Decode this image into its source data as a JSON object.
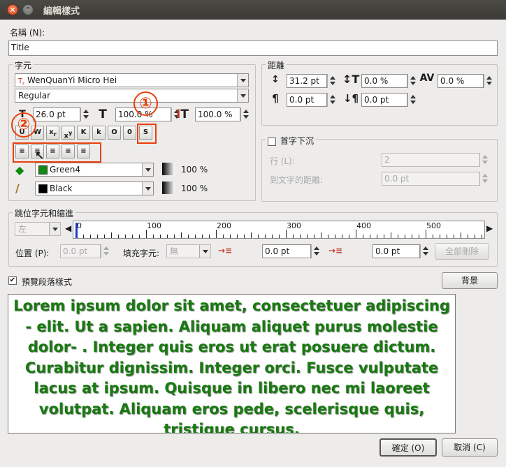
{
  "window": {
    "title": "編輯樣式"
  },
  "name": {
    "label": "名稱 (N):",
    "value": "Title"
  },
  "char_group": {
    "title": "字元",
    "font": "WenQuanYi Micro Hei",
    "style": "Regular",
    "size": "26.0 pt",
    "scale_h": "100.0 %",
    "scale_v": "100.0 %",
    "fill_color": "Green4",
    "fill_shade": "100 %",
    "stroke_color": "Black",
    "stroke_shade": "100 %",
    "marker1": "①",
    "marker2": "②"
  },
  "spacing_group": {
    "title": "距離",
    "line_spacing": "31.2 pt",
    "tracking": "0.0 %",
    "kerning": "0.0 %",
    "space_before": "0.0 pt",
    "space_after": "0.0 pt"
  },
  "dropcap": {
    "title": "首字下沉",
    "lines_label": "行 (L):",
    "lines_value": "2",
    "dist_label": "到文字的距離:",
    "dist_value": "0.0 pt"
  },
  "tabs": {
    "title": "跳位字元和縮進",
    "align": "左",
    "position_label": "位置 (P):",
    "position_value": "0.0 pt",
    "fill_label": "填充字元:",
    "fill_value": "無",
    "first_indent": "0.0 pt",
    "left_indent": "0.0 pt",
    "delete_all": "全部刪除",
    "ruler_labels": [
      "0",
      "100",
      "200",
      "300",
      "400",
      "500"
    ]
  },
  "preview": {
    "checkbox_label": "預覽段落樣式",
    "background_button": "背景",
    "text": "Lorem ipsum dolor sit amet, consectetuer adipiscing - elit. Ut a sapien. Aliquam aliquet purus molestie dolor- . Integer quis eros ut erat posuere dictum. Curabitur dignissim. Integer orci. Fusce vulputate lacus at ipsum. Quisque in libero nec mi laoreet volutpat. Aliquam eros pede, scelerisque quis, tristique cursus,"
  },
  "buttons": {
    "ok": "確定 (O)",
    "cancel": "取消 (C)"
  },
  "colors": {
    "fill": "#118a0e",
    "stroke": "#000000",
    "annotation": "#e8400c"
  }
}
